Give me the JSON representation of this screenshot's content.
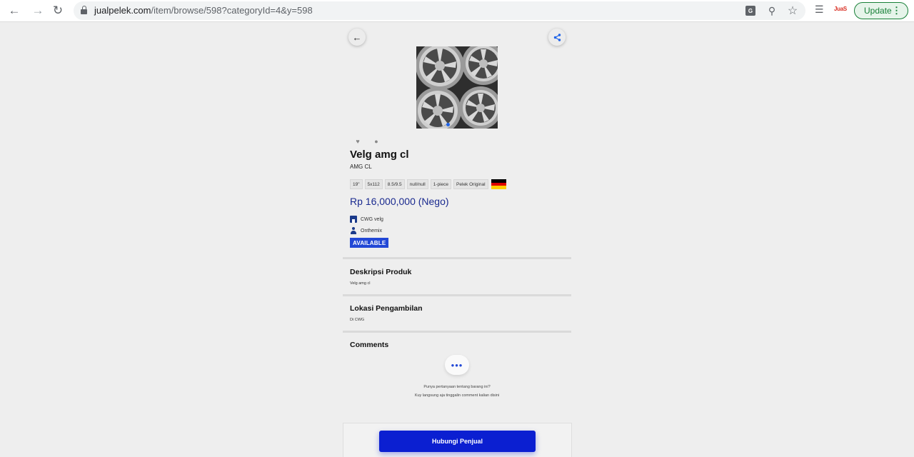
{
  "browser": {
    "url_host": "jualpelek.com",
    "url_path": "/item/browse/598?categoryId=4&y=598",
    "update_label": "Update",
    "ext_label": "JuaS"
  },
  "product": {
    "title": "Velg amg cl",
    "subtitle": "AMG CL",
    "specs": [
      "19\"",
      "5x112",
      "8.5/9.5",
      "null/null",
      "1-piece",
      "Pelek Original"
    ],
    "origin_flag_colors": [
      "#000000",
      "#dd0000",
      "#ffce00"
    ],
    "price": "Rp 16,000,000 (Nego)",
    "store": "CWG velg",
    "user": "Onthemix",
    "status": "AVAILABLE",
    "status_color": "#2248d6"
  },
  "sections": {
    "description_title": "Deskripsi Produk",
    "description_text": "Velg amg cl",
    "location_title": "Lokasi Pengambilan",
    "location_text": "Di CWG",
    "comments_title": "Comments",
    "comments_prompt_1": "Punya pertanyaan tentang barang ini?",
    "comments_prompt_2": "Kuy langsung aja tinggalin comment kalian disini"
  },
  "actions": {
    "contact_label": "Hubungi Penjual",
    "contact_color": "#0b1fd1"
  }
}
